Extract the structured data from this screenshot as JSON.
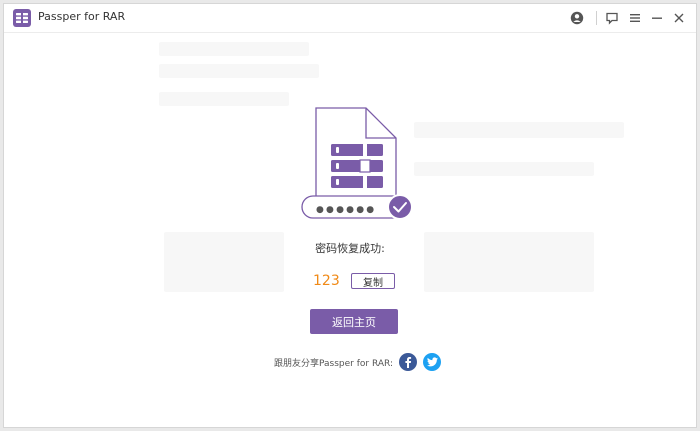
{
  "app": {
    "title": "Passper for RAR",
    "brand_color": "#7a5ca8"
  },
  "titlebar": {
    "icons": [
      "account-icon",
      "feedback-icon",
      "menu-icon",
      "minimize-icon",
      "close-icon"
    ]
  },
  "illustration": {
    "icons": [
      "archive-file-icon",
      "password-field-icon",
      "checkmark-icon"
    ],
    "masked_password": "●●●●●●"
  },
  "result": {
    "success_message": "密码恢复成功:",
    "password": "123",
    "password_color": "#f08a17",
    "copy_label": "复制"
  },
  "actions": {
    "home_label": "返回主页"
  },
  "share": {
    "label": "跟朋友分享Passper for RAR:",
    "facebook_icon": "facebook-icon",
    "twitter_icon": "twitter-icon",
    "facebook_color": "#3b5998",
    "twitter_color": "#1da1f2"
  }
}
